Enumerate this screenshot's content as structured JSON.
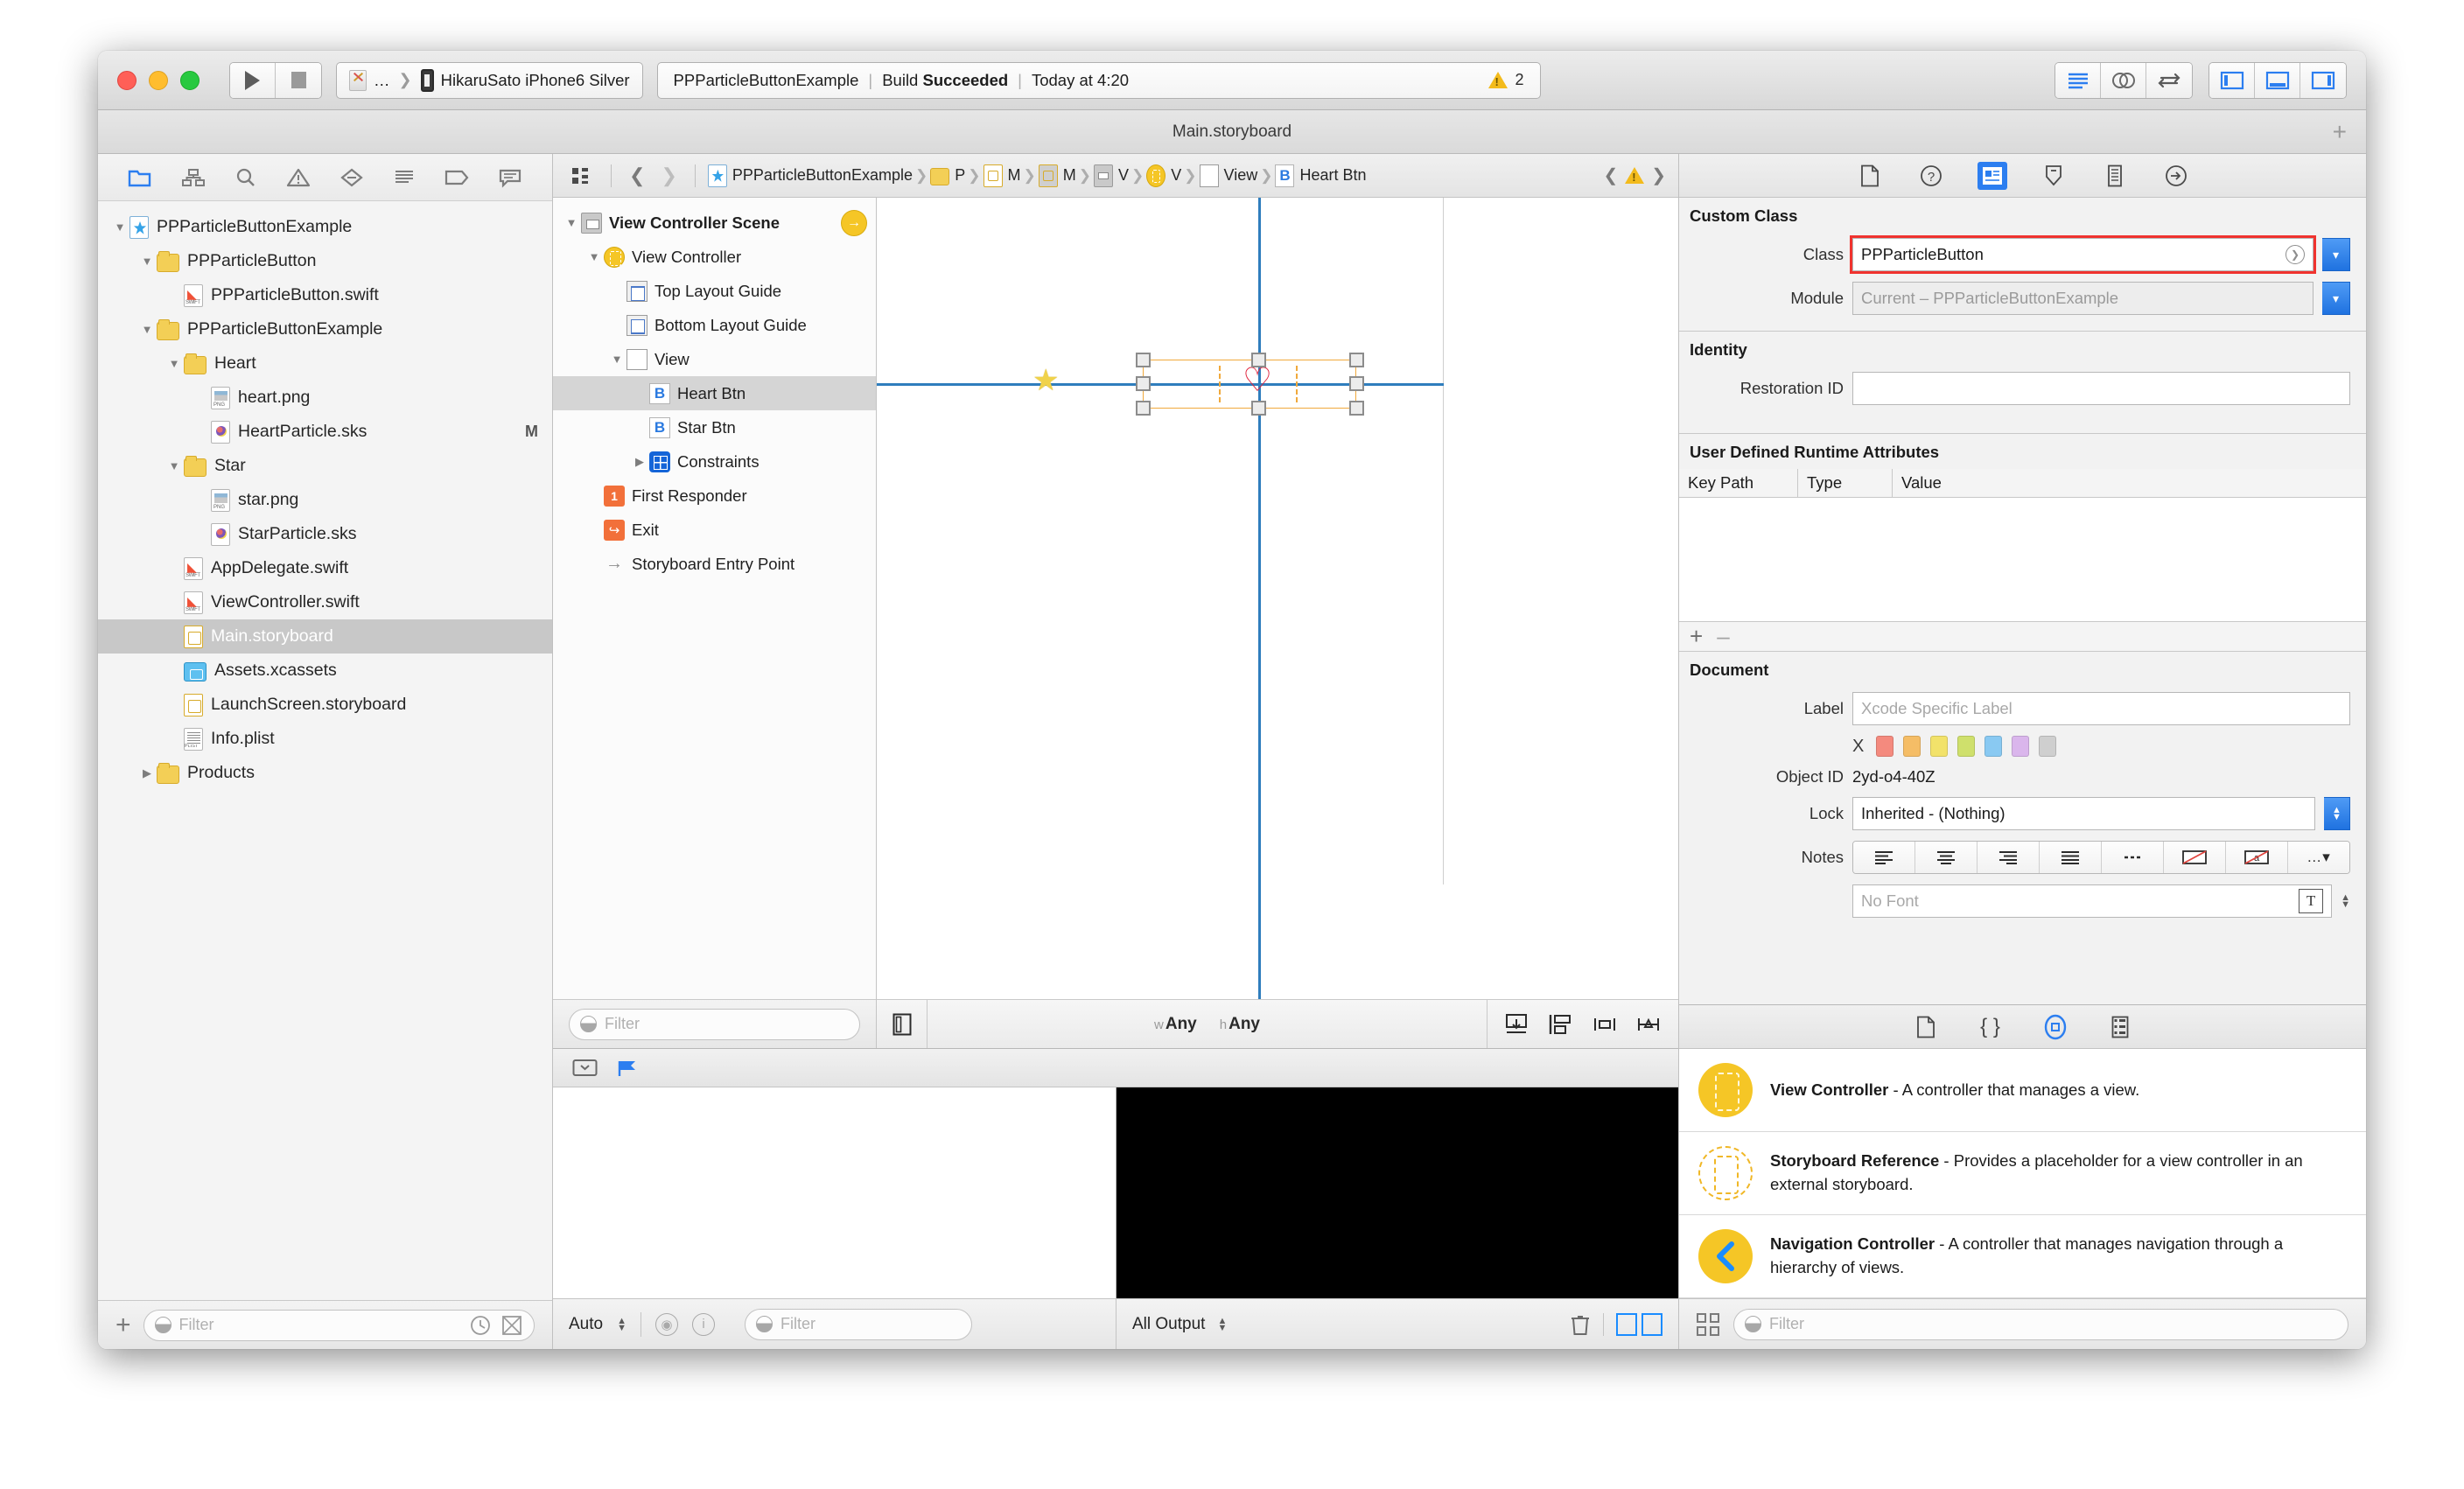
{
  "window": {
    "doc_title": "Main.storyboard",
    "add_label": "+"
  },
  "toolbar": {
    "scheme_app": "…",
    "scheme_device": "HikaruSato iPhone6 Silver",
    "status_project": "PPParticleButtonExample",
    "status_build_prefix": "Build",
    "status_build_result": "Succeeded",
    "status_time": "Today at 4:20",
    "warning_count": "2",
    "run_button": "run-button",
    "stop_button": "stop-button",
    "right_buttons": [
      "standard-editor",
      "assistant-editor",
      "version-editor",
      "toggle-navigator",
      "toggle-debug-area",
      "toggle-utilities"
    ]
  },
  "navigator": {
    "toolbar_icons": [
      "folder-icon",
      "source-control-icon",
      "search-icon",
      "warning-icon",
      "test-icon",
      "debug-icon",
      "breakpoint-icon",
      "report-icon"
    ],
    "items": [
      {
        "label": "PPParticleButtonExample",
        "indent": 0,
        "twisty": "open",
        "icon": "project",
        "badge": ""
      },
      {
        "label": "PPParticleButton",
        "indent": 1,
        "twisty": "open",
        "icon": "folder",
        "badge": ""
      },
      {
        "label": "PPParticleButton.swift",
        "indent": 2,
        "twisty": "",
        "icon": "swift",
        "badge": ""
      },
      {
        "label": "PPParticleButtonExample",
        "indent": 1,
        "twisty": "open",
        "icon": "folder",
        "badge": ""
      },
      {
        "label": "Heart",
        "indent": 2,
        "twisty": "open",
        "icon": "folder",
        "badge": ""
      },
      {
        "label": "heart.png",
        "indent": 3,
        "twisty": "",
        "icon": "png",
        "badge": ""
      },
      {
        "label": "HeartParticle.sks",
        "indent": 3,
        "twisty": "",
        "icon": "sks",
        "badge": "M"
      },
      {
        "label": "Star",
        "indent": 2,
        "twisty": "open",
        "icon": "folder",
        "badge": ""
      },
      {
        "label": "star.png",
        "indent": 3,
        "twisty": "",
        "icon": "png",
        "badge": ""
      },
      {
        "label": "StarParticle.sks",
        "indent": 3,
        "twisty": "",
        "icon": "sks",
        "badge": ""
      },
      {
        "label": "AppDelegate.swift",
        "indent": 2,
        "twisty": "",
        "icon": "swift",
        "badge": ""
      },
      {
        "label": "ViewController.swift",
        "indent": 2,
        "twisty": "",
        "icon": "swift",
        "badge": ""
      },
      {
        "label": "Main.storyboard",
        "indent": 2,
        "twisty": "",
        "icon": "story",
        "badge": "",
        "selected": true
      },
      {
        "label": "Assets.xcassets",
        "indent": 2,
        "twisty": "",
        "icon": "assets",
        "badge": ""
      },
      {
        "label": "LaunchScreen.storyboard",
        "indent": 2,
        "twisty": "",
        "icon": "story",
        "badge": ""
      },
      {
        "label": "Info.plist",
        "indent": 2,
        "twisty": "",
        "icon": "plist",
        "badge": ""
      },
      {
        "label": "Products",
        "indent": 1,
        "twisty": "closed",
        "icon": "folder",
        "badge": ""
      }
    ],
    "filter_placeholder": "Filter",
    "add_label": "+"
  },
  "jumpbar": {
    "crumbs": [
      {
        "label": "PPParticleButtonExample",
        "icon": "project-icon"
      },
      {
        "label": "P",
        "icon": "folder-icon"
      },
      {
        "label": "M",
        "icon": "storyboard-icon"
      },
      {
        "label": "M",
        "icon": "storyboard-scene-icon"
      },
      {
        "label": "V",
        "icon": "scene-icon"
      },
      {
        "label": "V",
        "icon": "view-controller-icon"
      },
      {
        "label": "View",
        "icon": "view-icon"
      },
      {
        "label": "Heart Btn",
        "icon": "button-icon"
      }
    ]
  },
  "outline": {
    "items": [
      {
        "label": "View Controller Scene",
        "indent": 0,
        "twisty": "open",
        "icon": "scene",
        "bold": true,
        "entry": true
      },
      {
        "label": "View Controller",
        "indent": 1,
        "twisty": "open",
        "icon": "vc"
      },
      {
        "label": "Top Layout Guide",
        "indent": 2,
        "twisty": "",
        "icon": "guide-top"
      },
      {
        "label": "Bottom Layout Guide",
        "indent": 2,
        "twisty": "",
        "icon": "guide-bottom"
      },
      {
        "label": "View",
        "indent": 2,
        "twisty": "open",
        "icon": "view"
      },
      {
        "label": "Heart Btn",
        "indent": 3,
        "twisty": "",
        "icon": "button",
        "selected": true
      },
      {
        "label": "Star Btn",
        "indent": 3,
        "twisty": "",
        "icon": "button"
      },
      {
        "label": "Constraints",
        "indent": 3,
        "twisty": "closed",
        "icon": "constraints"
      },
      {
        "label": "First Responder",
        "indent": 1,
        "twisty": "",
        "icon": "responder"
      },
      {
        "label": "Exit",
        "indent": 1,
        "twisty": "",
        "icon": "exit"
      },
      {
        "label": "Storyboard Entry Point",
        "indent": 1,
        "twisty": "",
        "icon": "entry-arrow"
      }
    ],
    "filter_placeholder": "Filter"
  },
  "canvas": {
    "size_w_unit": "w",
    "size_w_value": "Any",
    "size_h_unit": "h",
    "size_h_value": "Any",
    "bottom_icons": [
      "resolve-auto-layout-issues-icon",
      "update-frames-icon",
      "align-icon",
      "pin-icon"
    ],
    "star_glyph": "★",
    "heart_glyph": "♡"
  },
  "debug": {
    "auto_label": "Auto",
    "filter_placeholder": "Filter",
    "output_label": "All Output",
    "tool_icons": [
      "hide-debug-icon",
      "flag-icon",
      "eye-icon",
      "info-icon",
      "trash-icon"
    ]
  },
  "inspector": {
    "tabs": [
      "file-inspector-icon",
      "quick-help-icon",
      "identity-inspector-icon",
      "attributes-inspector-icon",
      "size-inspector-icon",
      "connections-inspector-icon"
    ],
    "active_tab_index": 2,
    "custom_class": {
      "heading": "Custom Class",
      "class_label": "Class",
      "class_value": "PPParticleButton",
      "module_label": "Module",
      "module_value": "Current – PPParticleButtonExample",
      "highlight_color": "#f0332f"
    },
    "identity": {
      "heading": "Identity",
      "restoration_label": "Restoration ID",
      "restoration_value": ""
    },
    "runtime_attributes": {
      "heading": "User Defined Runtime Attributes",
      "columns": [
        "Key Path",
        "Type",
        "Value"
      ],
      "rows": [],
      "add_label": "+",
      "remove_label": "–"
    },
    "document": {
      "heading": "Document",
      "label_label": "Label",
      "label_placeholder": "Xcode Specific Label",
      "swatch_clear": "X",
      "swatches": [
        "#f48a7e",
        "#f5bd66",
        "#f2e26a",
        "#cfe06c",
        "#89c9f2",
        "#dab6ec",
        "#cfcfcf"
      ],
      "objectid_label": "Object ID",
      "objectid_value": "2yd-o4-40Z",
      "lock_label": "Lock",
      "lock_value": "Inherited - (Nothing)",
      "notes_label": "Notes",
      "notes_segments": [
        "align-left-icon",
        "align-center-icon",
        "align-right-icon",
        "align-justify-icon",
        "list-icon",
        "no-color-icon",
        "no-font-color-icon",
        "more-icon"
      ],
      "font_placeholder": "No Font"
    }
  },
  "library": {
    "tabs": [
      "file-template-library-icon",
      "code-snippet-library-icon",
      "object-library-icon",
      "media-library-icon"
    ],
    "active_tab_index": 2,
    "items": [
      {
        "title": "View Controller",
        "desc": " - A controller that manages a view.",
        "icon": "view-controller-icon"
      },
      {
        "title": "Storyboard Reference",
        "desc": " - Provides a placeholder for a view controller in an external storyboard.",
        "icon": "storyboard-reference-icon"
      },
      {
        "title": "Navigation Controller",
        "desc": " - A controller that manages navigation through a hierarchy of views.",
        "icon": "navigation-controller-icon"
      }
    ],
    "filter_placeholder": "Filter"
  }
}
